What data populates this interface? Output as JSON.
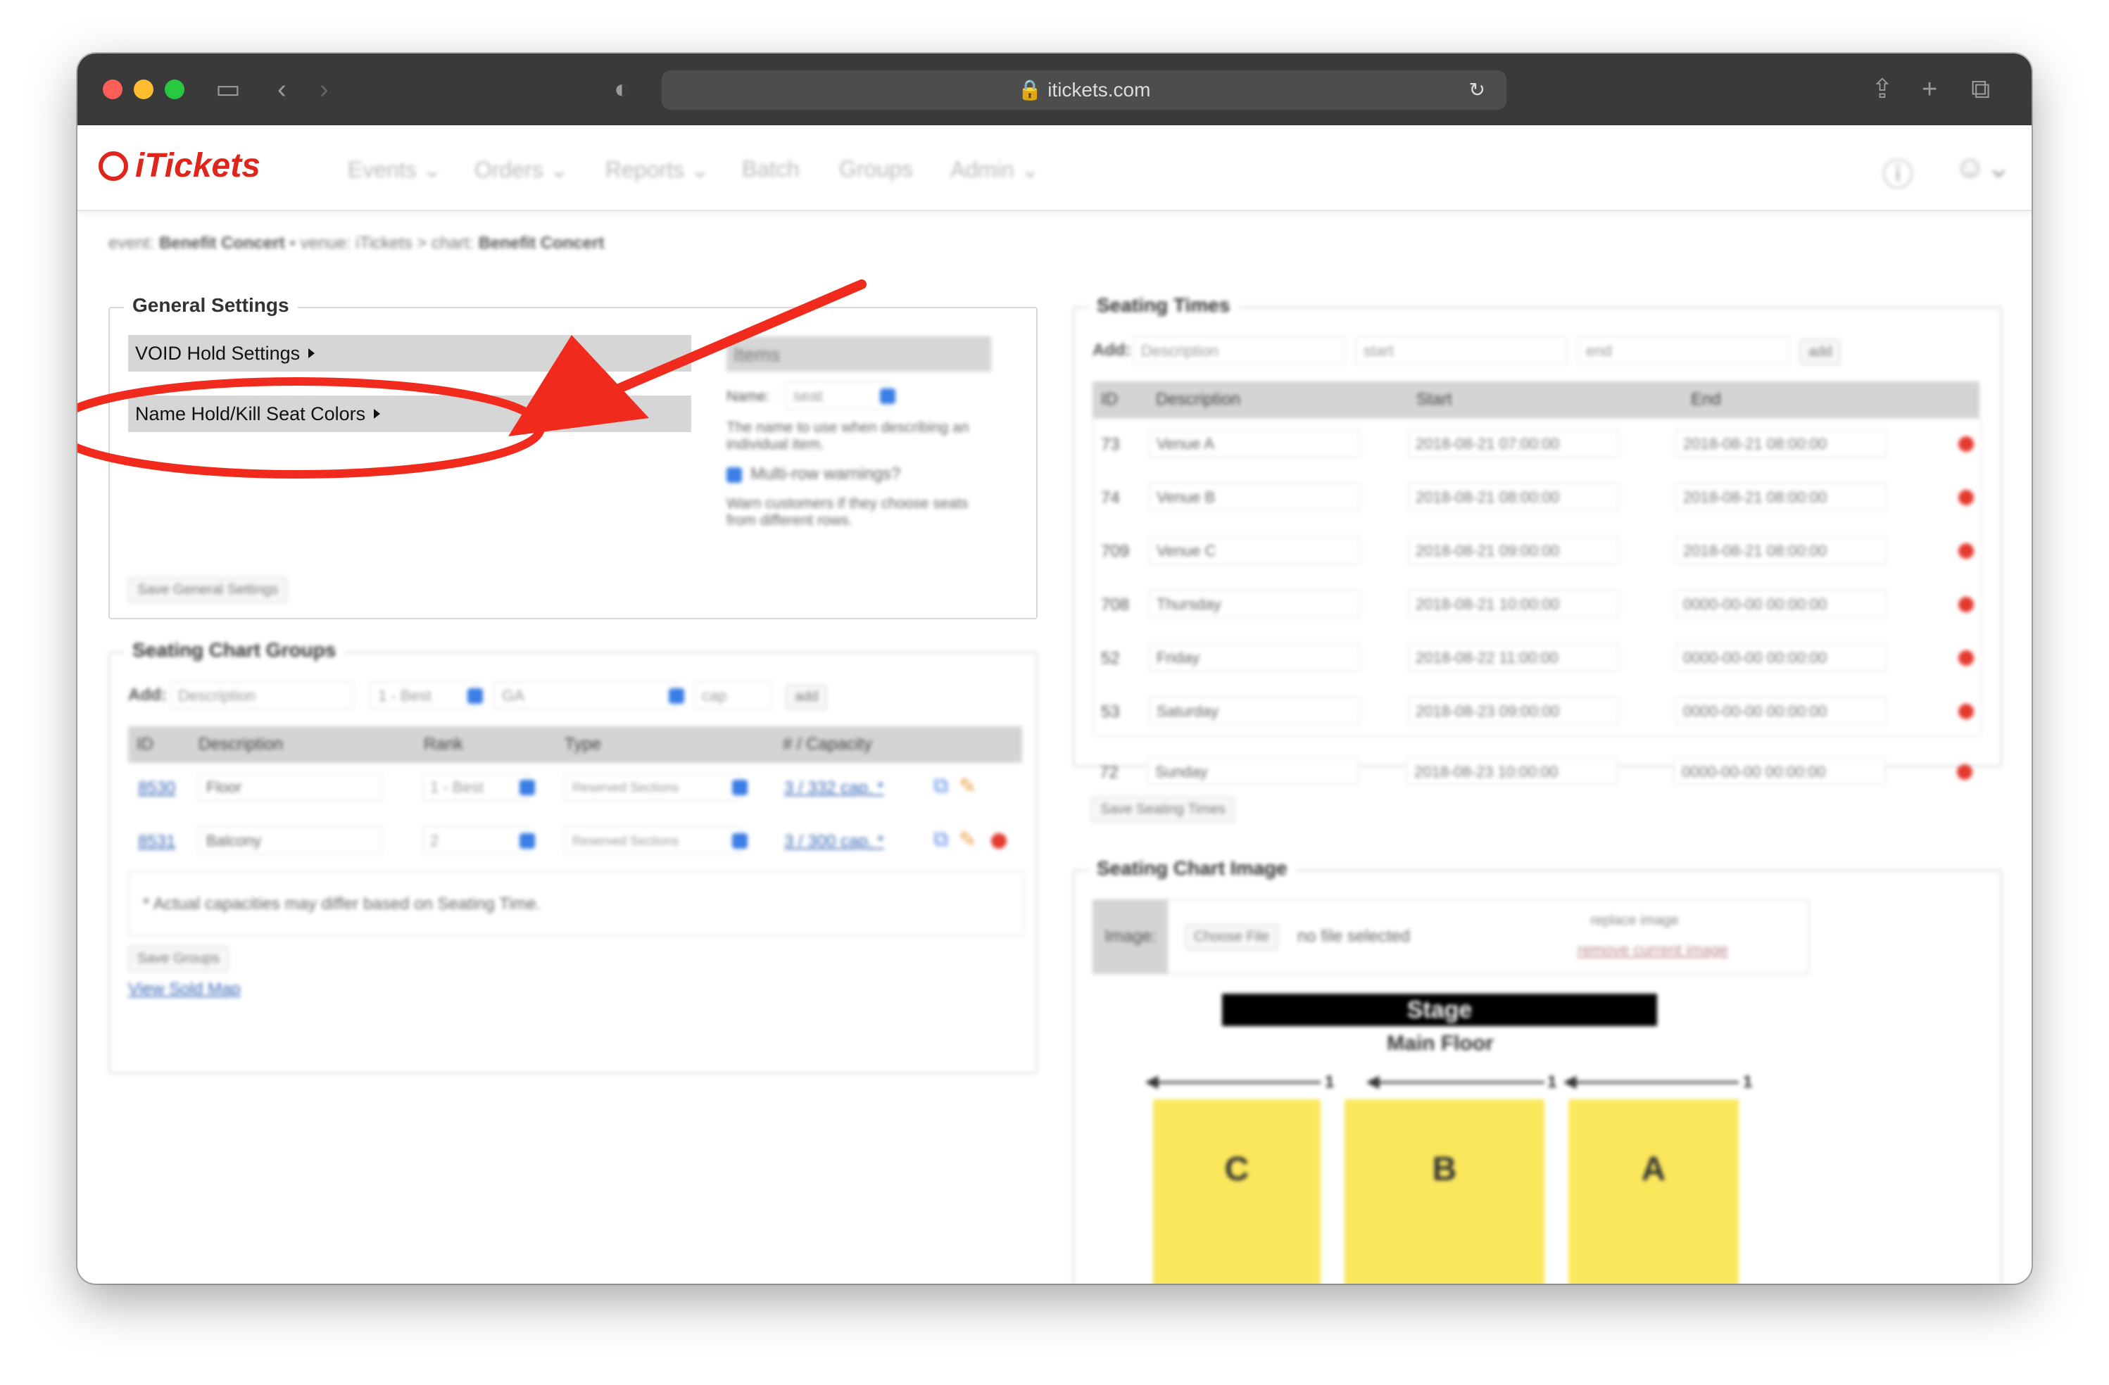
{
  "browser": {
    "url": "itickets.com"
  },
  "app": {
    "logo_text": "iTickets",
    "nav": [
      "Events ⌄",
      "Orders ⌄",
      "Reports ⌄",
      "Batch",
      "Groups",
      "Admin ⌄"
    ]
  },
  "breadcrumb": {
    "event_label": "event:",
    "event_value": "Benefit Concert",
    "venue_label": "• venue:",
    "venue_value": "iTickets",
    "chart_label": "> chart:",
    "chart_value": "Benefit Concert"
  },
  "general_settings": {
    "title": "General Settings",
    "void_hold": "VOID Hold Settings",
    "name_hold": "Name Hold/Kill Seat Colors",
    "items_header": "Items",
    "name_label": "Name:",
    "name_value": "seat",
    "name_help": "The name to use when describing an individual item.",
    "multirow_label": "Multi-row warnings?",
    "multirow_help": "Warn customers if they choose seats from different rows.",
    "save": "Save General Settings"
  },
  "seating_chart_groups": {
    "title": "Seating Chart Groups",
    "add_label": "Add:",
    "description_placeholder": "Description",
    "rank_default": "1 - Best",
    "type_default": "GA",
    "cap_placeholder": "cap",
    "add_button": "add",
    "headers": [
      "ID",
      "Description",
      "Rank",
      "Type",
      "# / Capacity"
    ],
    "rows": [
      {
        "id": "8530",
        "description": "Floor",
        "rank": "1 - Best",
        "type": "Reserved Sections",
        "capacity": "3 / 332 cap. *"
      },
      {
        "id": "8531",
        "description": "Balcony",
        "rank": "2",
        "type": "Reserved Sections",
        "capacity": "3 / 300 cap. *"
      }
    ],
    "footnote": "* Actual capacities may differ based on Seating Time.",
    "save": "Save Groups",
    "view_sold_map": "View Sold Map"
  },
  "seating_times": {
    "title": "Seating Times",
    "add_label": "Add:",
    "description_placeholder": "Description",
    "start_placeholder": "start",
    "end_placeholder": "end",
    "add_button": "add",
    "headers": [
      "ID",
      "Description",
      "Start",
      "End"
    ],
    "rows": [
      {
        "id": "73",
        "description": "Venue A",
        "start": "2018-08-21 07:00:00",
        "end": "2018-08-21 08:00:00"
      },
      {
        "id": "74",
        "description": "Venue B",
        "start": "2018-08-21 08:00:00",
        "end": "2018-08-21 08:00:00"
      },
      {
        "id": "709",
        "description": "Venue C",
        "start": "2018-08-21 09:00:00",
        "end": "2018-08-21 08:00:00"
      },
      {
        "id": "708",
        "description": "Thursday",
        "start": "2018-08-21 10:00:00",
        "end": "0000-00-00 00:00:00"
      },
      {
        "id": "52",
        "description": "Friday",
        "start": "2018-08-22 11:00:00",
        "end": "0000-00-00 00:00:00"
      },
      {
        "id": "53",
        "description": "Saturday",
        "start": "2018-08-23 09:00:00",
        "end": "0000-00-00 00:00:00"
      },
      {
        "id": "72",
        "description": "Sunday",
        "start": "2018-08-23 10:00:00",
        "end": "0000-00-00 00:00:00"
      }
    ],
    "save": "Save Seating Times"
  },
  "seating_chart_image": {
    "title": "Seating Chart Image",
    "image_label": "Image:",
    "choose_file": "Choose File",
    "no_file": "no file selected",
    "replace": "replace image",
    "remove": "remove current image",
    "stage": "Stage",
    "main_floor": "Main Floor",
    "sections": [
      "C",
      "B",
      "A"
    ],
    "arrow_numbers": [
      "1",
      "1",
      "1"
    ]
  },
  "colors": {
    "accent_red": "#e0261c",
    "annotation_red": "#f02a1c",
    "seat_yellow": "#fbe75c"
  }
}
